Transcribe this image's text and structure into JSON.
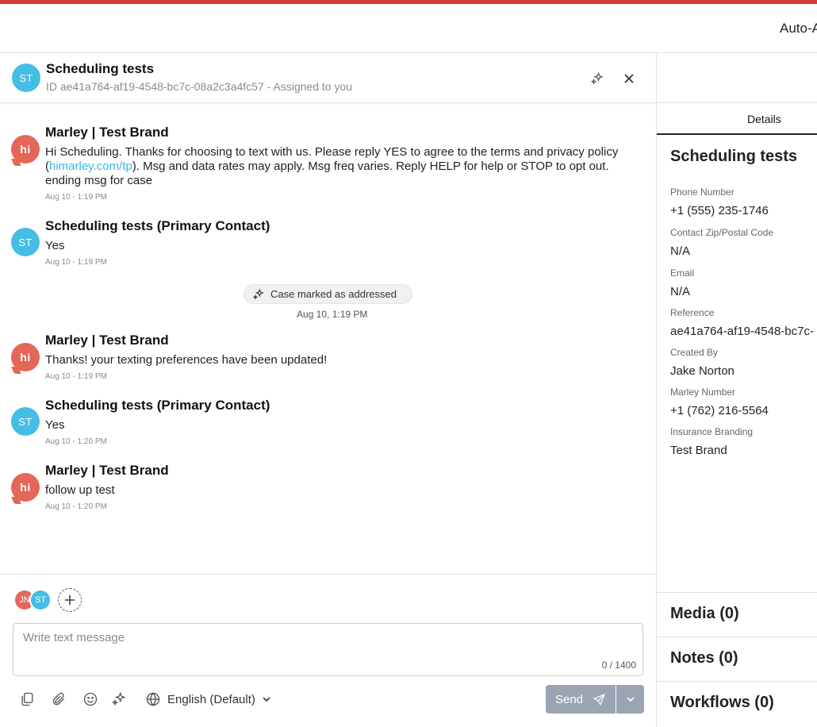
{
  "topbar": {
    "right_text": "Auto-A"
  },
  "chat_header": {
    "avatar_initials": "ST",
    "title": "Scheduling tests",
    "subtitle": "ID ae41a764-af19-4548-bc7c-08a2c3a4fc57 - Assigned to you",
    "icons": [
      "sparkle-icon",
      "close-icon"
    ]
  },
  "messages": [
    {
      "author": "Marley | Test Brand",
      "avatar": "hi",
      "body_pre": "Hi Scheduling. Thanks for choosing to text with us. Please reply YES to agree to the terms and privacy policy (",
      "body_link": "himarley.com/tp",
      "body_post": "). Msg and data rates may apply. Msg freq varies. Reply HELP for help or STOP to opt out. ending msg for case",
      "time": "Aug 10 - 1:19 PM"
    },
    {
      "author": "Scheduling tests (Primary Contact)",
      "avatar": "ST",
      "body": "Yes",
      "time": "Aug 10 - 1:19 PM"
    },
    {
      "author": "Marley | Test Brand",
      "avatar": "hi",
      "body": "Thanks! your texting preferences have been updated!",
      "time": "Aug 10 - 1:19 PM"
    },
    {
      "author": "Scheduling tests (Primary Contact)",
      "avatar": "ST",
      "body": "Yes",
      "time": "Aug 10 - 1:20 PM"
    },
    {
      "author": "Marley | Test Brand",
      "avatar": "hi",
      "body": "follow up test",
      "time": "Aug 10 - 1:20 PM"
    }
  ],
  "event": {
    "label": "Case marked as addressed",
    "time": "Aug 10, 1:19 PM"
  },
  "composer": {
    "participants": [
      {
        "initials": "JN",
        "color": "#e4675a"
      },
      {
        "initials": "ST",
        "color": "#45bde5"
      }
    ],
    "placeholder": "Write text message",
    "counter": "0 / 1400",
    "language": "English (Default)",
    "send_label": "Send"
  },
  "details": {
    "tab": "Details",
    "title": "Scheduling tests",
    "fields": [
      {
        "label": "Phone Number",
        "value": "+1 (555) 235-1746"
      },
      {
        "label": "Contact Zip/Postal Code",
        "value": "N/A"
      },
      {
        "label": "Email",
        "value": "N/A"
      },
      {
        "label": "Reference",
        "value": "ae41a764-af19-4548-bc7c-"
      },
      {
        "label": "Created By",
        "value": "Jake Norton"
      },
      {
        "label": "Marley Number",
        "value": "+1 (762) 216-5564"
      },
      {
        "label": "Insurance Branding",
        "value": "Test Brand"
      }
    ],
    "sections": [
      "Media (0)",
      "Notes (0)",
      "Workflows (0)"
    ]
  },
  "colors": {
    "accent_red": "#d63b3b",
    "avatar_blue": "#45bde5",
    "brand_red": "#e4675a",
    "link": "#3ab6df",
    "send_button": "#9aa4b3"
  }
}
